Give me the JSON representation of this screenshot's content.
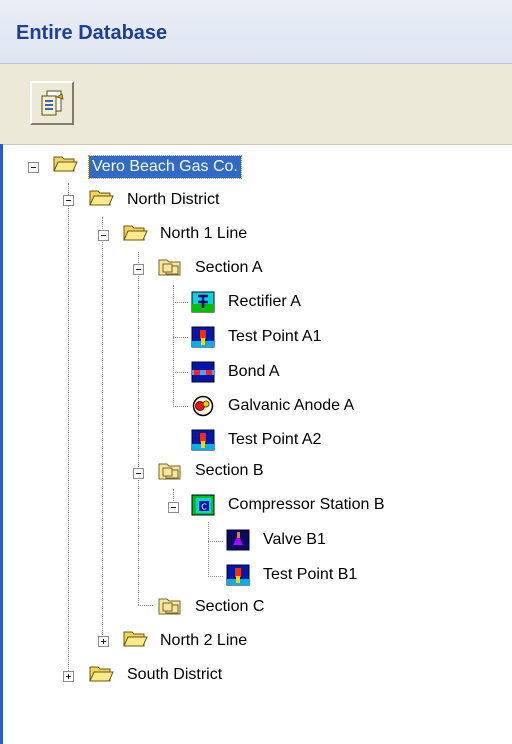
{
  "header": {
    "title": "Entire Database"
  },
  "toolbar": {
    "buttons": [
      {
        "icon": "properties-icon"
      }
    ]
  },
  "tree": {
    "selected": "Vero Beach Gas Co.",
    "nodes": [
      {
        "label": "Vero Beach Gas Co.",
        "icon": "folder-open-icon",
        "state": "expanded"
      },
      {
        "label": "North District",
        "icon": "folder-open-icon",
        "state": "expanded"
      },
      {
        "label": "North 1 Line",
        "icon": "folder-open-icon",
        "state": "expanded"
      },
      {
        "label": "Section A",
        "icon": "section-folder-icon",
        "state": "expanded"
      },
      {
        "label": "Rectifier A",
        "icon": "rectifier-icon"
      },
      {
        "label": "Test Point A1",
        "icon": "test-point-icon"
      },
      {
        "label": "Bond A",
        "icon": "bond-icon"
      },
      {
        "label": "Galvanic Anode A",
        "icon": "galvanic-anode-icon"
      },
      {
        "label": "Test Point A2",
        "icon": "test-point-icon"
      },
      {
        "label": "Section B",
        "icon": "section-folder-icon",
        "state": "expanded"
      },
      {
        "label": "Compressor Station B",
        "icon": "compressor-station-icon",
        "state": "expanded"
      },
      {
        "label": "Valve B1",
        "icon": "valve-icon"
      },
      {
        "label": "Test Point B1",
        "icon": "test-point-icon"
      },
      {
        "label": "Section C",
        "icon": "section-folder-icon"
      },
      {
        "label": "North 2 Line",
        "icon": "folder-closed-icon",
        "state": "collapsed"
      },
      {
        "label": "South District",
        "icon": "folder-closed-icon",
        "state": "collapsed"
      }
    ]
  }
}
